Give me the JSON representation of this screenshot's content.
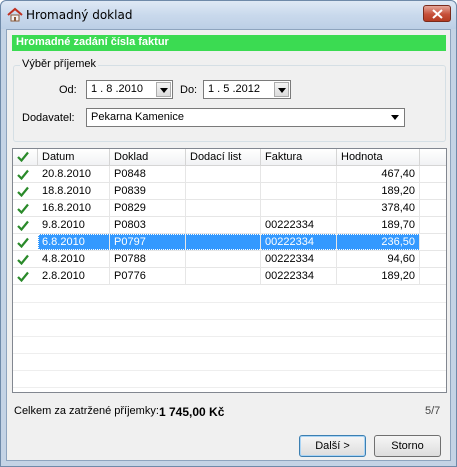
{
  "window": {
    "title": "Hromadný doklad"
  },
  "header": {
    "title": "Hromadné zadání čísla faktur"
  },
  "receipts_selection": {
    "legend": "Výběr příjemek",
    "from_label": "Od:",
    "from_value": "1 . 8 .2010",
    "to_label": "Do:",
    "to_value": "1 . 5 .2012",
    "supplier_label": "Dodavatel:",
    "supplier_value": "Pekarna Kamenice"
  },
  "table": {
    "columns": [
      "Datum",
      "Doklad",
      "Dodací list",
      "Faktura",
      "Hodnota"
    ],
    "rows": [
      {
        "datum": "20.8.2010",
        "doklad": "P0848",
        "dodaci": "",
        "faktura": "",
        "hodnota": "467,40"
      },
      {
        "datum": "18.8.2010",
        "doklad": "P0839",
        "dodaci": "",
        "faktura": "",
        "hodnota": "189,20"
      },
      {
        "datum": "16.8.2010",
        "doklad": "P0829",
        "dodaci": "",
        "faktura": "",
        "hodnota": "378,40"
      },
      {
        "datum": "9.8.2010",
        "doklad": "P0803",
        "dodaci": "",
        "faktura": "00222334",
        "hodnota": "189,70"
      },
      {
        "datum": "6.8.2010",
        "doklad": "P0797",
        "dodaci": "",
        "faktura": "00222334",
        "hodnota": "236,50"
      },
      {
        "datum": "4.8.2010",
        "doklad": "P0788",
        "dodaci": "",
        "faktura": "00222334",
        "hodnota": "94,60"
      },
      {
        "datum": "2.8.2010",
        "doklad": "P0776",
        "dodaci": "",
        "faktura": "00222334",
        "hodnota": "189,20"
      }
    ],
    "selected_row": 4
  },
  "footer": {
    "total_label": "Celkem za zatržené příjemky:",
    "total_value": "1 745,00 Kč",
    "page_count": "5/7"
  },
  "buttons": {
    "next": "Další >",
    "cancel": "Storno"
  },
  "colors": {
    "header_green": "#3bdb52",
    "selection": "#3399ff",
    "check": "#2a8a2a"
  }
}
